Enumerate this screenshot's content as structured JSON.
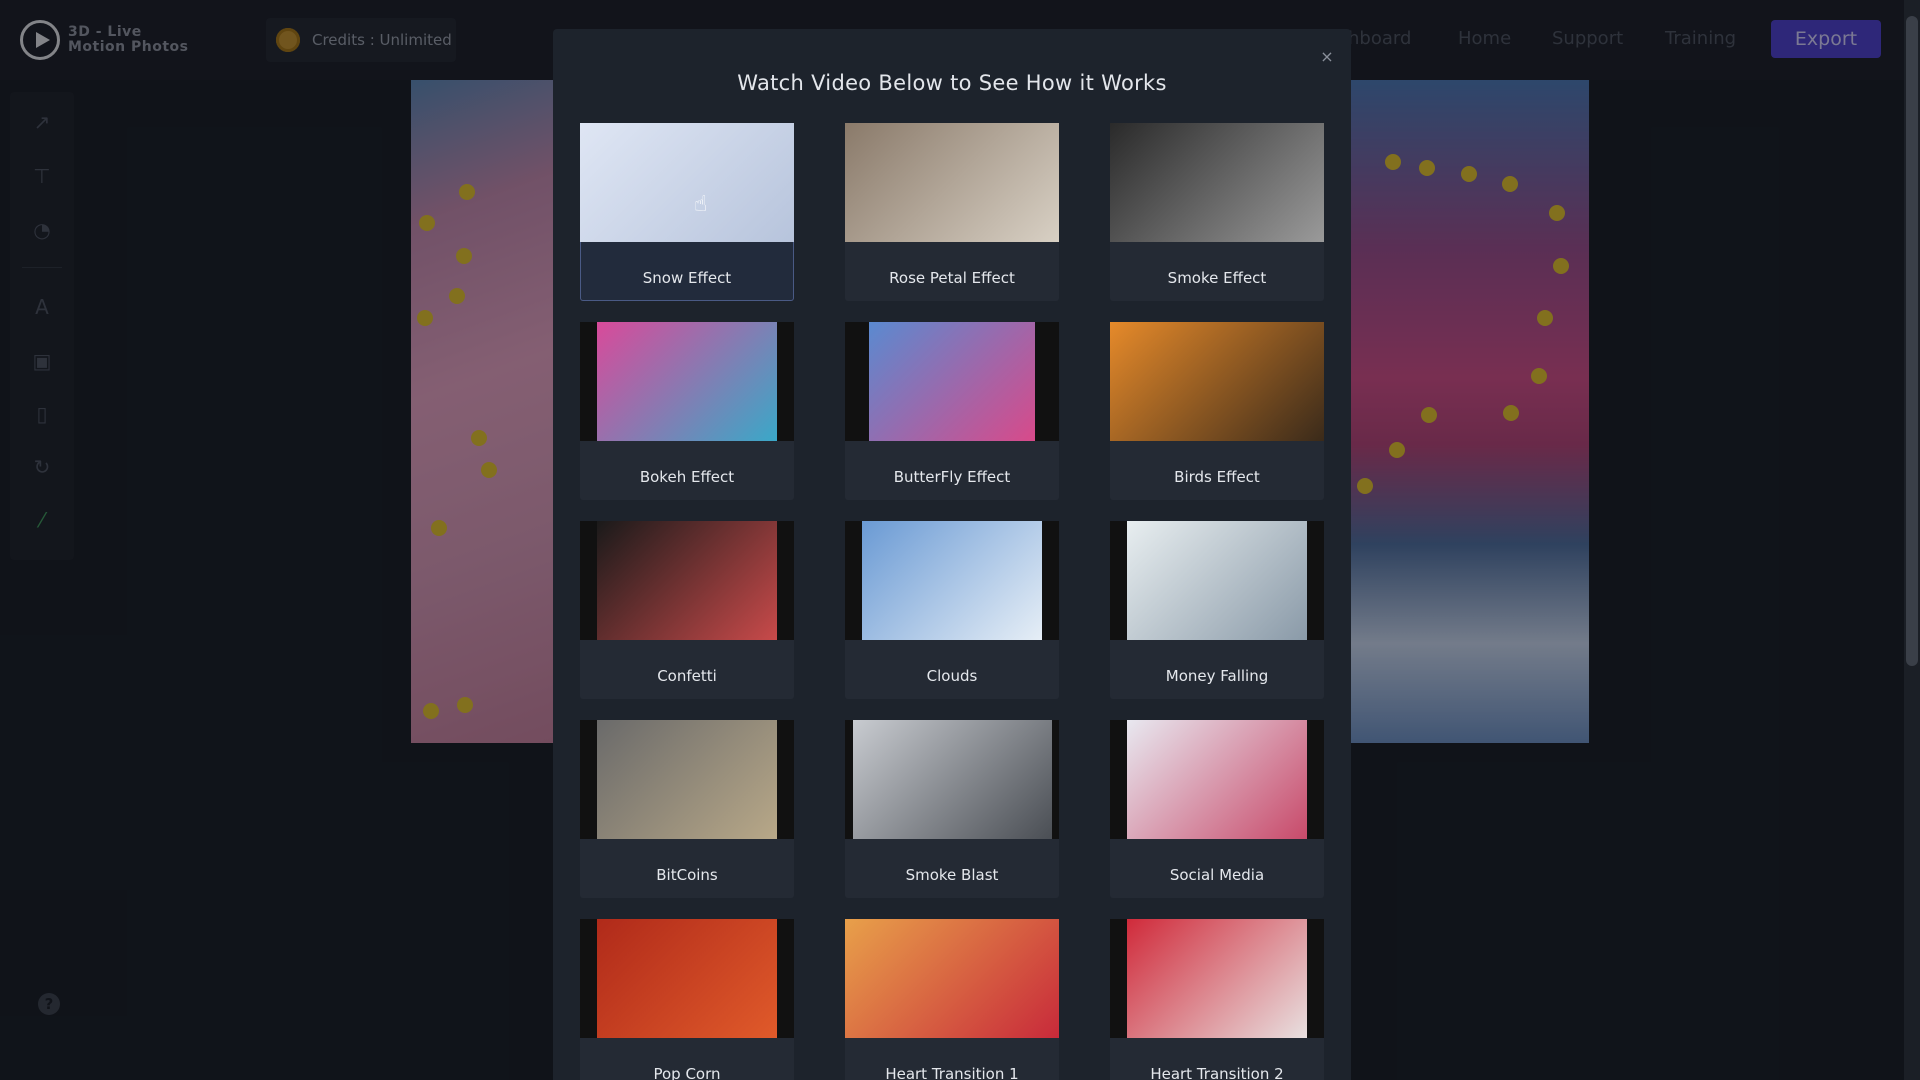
{
  "app": {
    "logo_line1": "3D - Live",
    "logo_line2": "Motion Photos",
    "credits": "Credits : Unlimited"
  },
  "nav": {
    "dashboard": "hboard",
    "home": "Home",
    "support": "Support",
    "training": "Training",
    "export": "Export"
  },
  "toolbar": {
    "icons": [
      "arrow-icon",
      "pin-icon",
      "speed-icon",
      "text-icon",
      "add-image-icon",
      "trash-icon",
      "reset-icon",
      "magic-wand-icon"
    ],
    "help": "?"
  },
  "modal": {
    "title": "Watch Video Below to See How it Works",
    "close": "×",
    "effects": [
      {
        "label": "Snow Effect",
        "colors": [
          "#dfe6f4",
          "#b7c4dc"
        ]
      },
      {
        "label": "Rose Petal Effect",
        "colors": [
          "#8a7a6a",
          "#d8d0c4"
        ]
      },
      {
        "label": "Smoke Effect",
        "colors": [
          "#2a2a2a",
          "#9a9a9a"
        ]
      },
      {
        "label": "Bokeh Effect",
        "colors": [
          "#d94a9a",
          "#3aa8c8"
        ]
      },
      {
        "label": "ButterFly Effect",
        "colors": [
          "#5a8ad0",
          "#d84a8a"
        ]
      },
      {
        "label": "Birds Effect",
        "colors": [
          "#e68a2a",
          "#3a2a1a"
        ]
      },
      {
        "label": "Confetti",
        "colors": [
          "#1a1a1a",
          "#c84a4a"
        ]
      },
      {
        "label": "Clouds",
        "colors": [
          "#6a9ad4",
          "#e6eef6"
        ]
      },
      {
        "label": "Money Falling",
        "colors": [
          "#e8eef0",
          "#8a9aa8"
        ]
      },
      {
        "label": "BitCoins",
        "colors": [
          "#6a6a6a",
          "#b8a888"
        ]
      },
      {
        "label": "Smoke Blast",
        "colors": [
          "#c8cbd0",
          "#4a4e54"
        ]
      },
      {
        "label": "Social Media",
        "colors": [
          "#e8e8f0",
          "#c84a6a"
        ]
      },
      {
        "label": "Pop Corn",
        "colors": [
          "#b02a1a",
          "#e05a2a"
        ]
      },
      {
        "label": "Heart Transition 1",
        "colors": [
          "#e8a04a",
          "#c82a3a"
        ]
      },
      {
        "label": "Heart Transition 2",
        "colors": [
          "#d02a3a",
          "#e8e0e0"
        ]
      }
    ]
  }
}
